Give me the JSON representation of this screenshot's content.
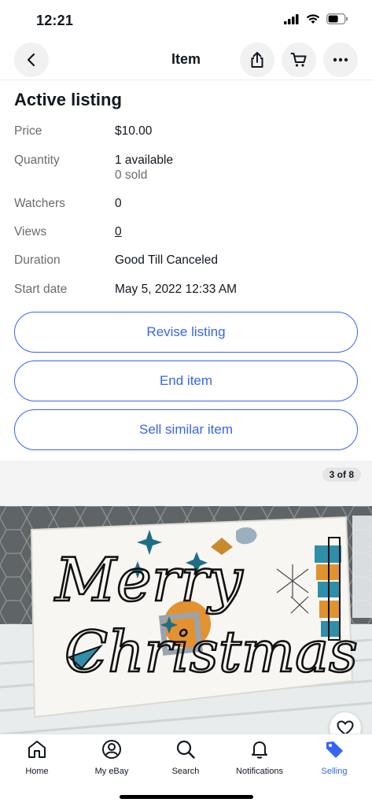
{
  "status": {
    "time": "12:21"
  },
  "nav": {
    "title": "Item",
    "back_icon": "back-arrow-icon",
    "share_icon": "share-icon",
    "cart_icon": "cart-icon",
    "more_icon": "more-dots-icon"
  },
  "listing": {
    "section_title": "Active listing",
    "price_label": "Price",
    "price_value": "$10.00",
    "quantity_label": "Quantity",
    "quantity_value": "1 available",
    "quantity_sold": "0 sold",
    "watchers_label": "Watchers",
    "watchers_value": "0",
    "views_label": "Views",
    "views_value": "0",
    "duration_label": "Duration",
    "duration_value": "Good Till Canceled",
    "start_label": "Start date",
    "start_value": "May 5, 2022 12:33 AM"
  },
  "actions": {
    "revise": "Revise listing",
    "end": "End item",
    "sell_similar": "Sell similar item"
  },
  "gallery": {
    "counter": "3 of 8",
    "photo_text_line1": "Merry",
    "photo_text_line2": "Christmas"
  },
  "tabs": [
    {
      "label": "Home",
      "icon": "home-icon"
    },
    {
      "label": "My eBay",
      "icon": "profile-icon"
    },
    {
      "label": "Search",
      "icon": "search-icon"
    },
    {
      "label": "Notifications",
      "icon": "bell-icon"
    },
    {
      "label": "Selling",
      "icon": "tag-icon"
    }
  ],
  "colors": {
    "accent": "#3665f3",
    "text": "#111820",
    "muted": "#6b6b6b"
  }
}
